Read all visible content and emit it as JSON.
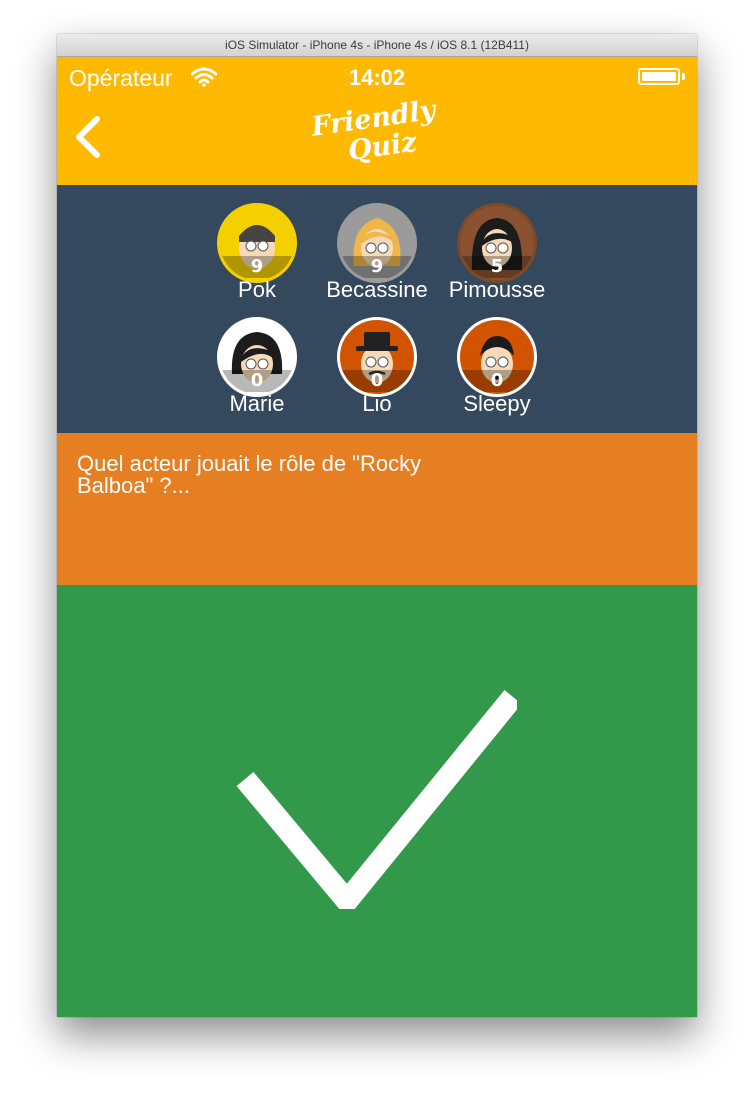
{
  "window": {
    "title": "iOS Simulator - iPhone 4s - iPhone 4s / iOS 8.1 (12B411)"
  },
  "status_bar": {
    "carrier": "Opérateur",
    "time": "14:02",
    "wifi_icon": "wifi-icon",
    "battery_icon": "battery-icon"
  },
  "nav": {
    "back_icon": "chevron-left-icon",
    "logo_line1": "Friendly",
    "logo_line2": "Quiz"
  },
  "players": [
    {
      "name": "Pok",
      "score": "9",
      "ring": "#f4d000",
      "bg": "#f4d000"
    },
    {
      "name": "Becassine",
      "score": "9",
      "ring": "#9b9b9b",
      "bg": "#9b9b9b"
    },
    {
      "name": "Pimousse",
      "score": "5",
      "ring": "#7a4a2a",
      "bg": "#8a5230"
    },
    {
      "name": "Marie",
      "score": "0",
      "ring": "#ffffff",
      "bg": "#ffffff"
    },
    {
      "name": "Lio",
      "score": "0",
      "ring": "#ffffff",
      "bg": "#d35400"
    },
    {
      "name": "Sleepy",
      "score": "0",
      "ring": "#ffffff",
      "bg": "#d35400"
    }
  ],
  "question": {
    "text": "Quel acteur jouait le rôle de \"Rocky Balboa\" ?..."
  },
  "result": {
    "icon": "checkmark-icon",
    "state": "correct"
  },
  "colors": {
    "header": "#feb900",
    "players_bg": "#34495e",
    "question_bg": "#e67e22",
    "result_bg": "#32984a"
  }
}
